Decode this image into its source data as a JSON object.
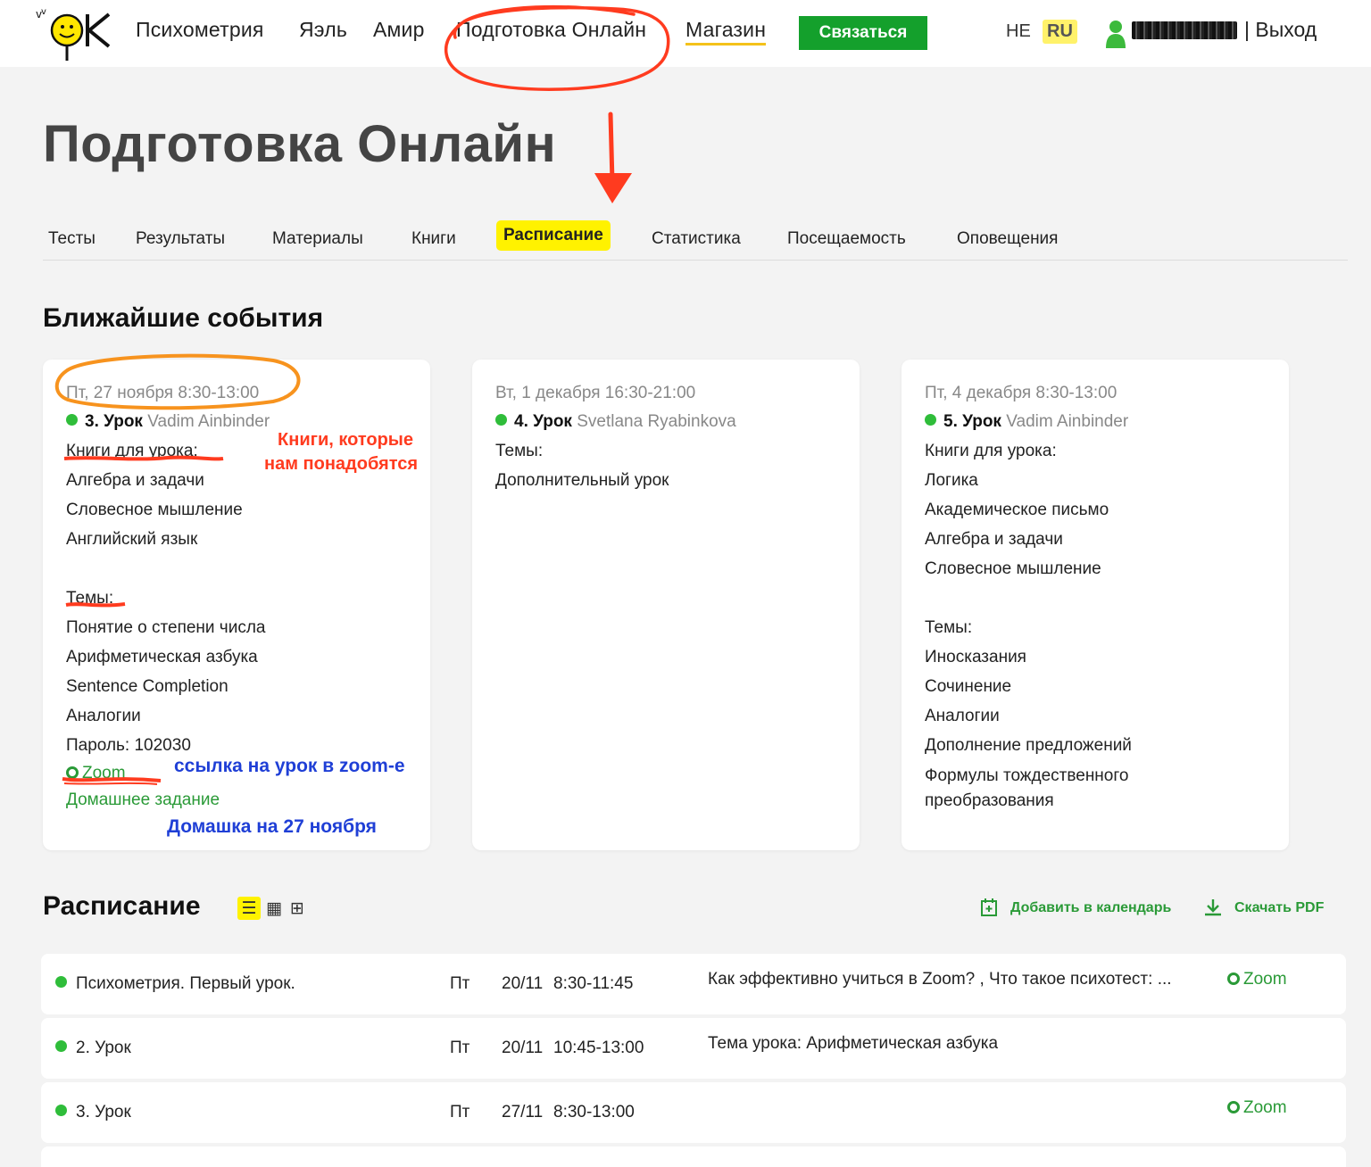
{
  "nav": {
    "links": [
      "Психометрия",
      "Яэль",
      "Амир",
      "Подготовка Онлайн",
      "Магазин"
    ],
    "contact_label": "Связаться",
    "lang_he": "HE",
    "lang_ru": "RU",
    "logout_label": "| Выход"
  },
  "page_title": "Подготовка Онлайн",
  "tabs": [
    "Тесты",
    "Результаты",
    "Материалы",
    "Книги",
    "Расписание",
    "Статистика",
    "Посещаемость",
    "Оповещения"
  ],
  "active_tab": "Расписание",
  "upcoming": {
    "heading": "Ближайшие события",
    "cards": [
      {
        "date": "Пт, 27 ноября 8:30-13:00",
        "lesson": "3. Урок",
        "teacher": "Vadim Ainbinder",
        "books_label": "Книги для урока:",
        "books": [
          "Алгебра и задачи",
          "Словесное мышление",
          "Английский язык"
        ],
        "topics_label": "Темы:",
        "topics": [
          "Понятие о степени числа",
          "Арифметическая азбука",
          "Sentence Completion",
          "Аналогии"
        ],
        "password": "Пароль: 102030",
        "zoom_label": "Zoom",
        "homework_label": "Домашнее задание"
      },
      {
        "date": "Вт, 1 декабря 16:30-21:00",
        "lesson": "4. Урок",
        "teacher": "Svetlana Ryabinkova",
        "topics_label": "Темы:",
        "topics": [
          "Дополнительный урок"
        ]
      },
      {
        "date": "Пт, 4 декабря 8:30-13:00",
        "lesson": "5. Урок",
        "teacher": "Vadim Ainbinder",
        "books_label": "Книги для урока:",
        "books": [
          "Логика",
          "Академическое письмо",
          "Алгебра и задачи",
          "Словесное мышление"
        ],
        "topics_label": "Темы:",
        "topics": [
          "Иносказания",
          "Сочинение",
          "Аналогии",
          "Дополнение предложений",
          "Формулы тождественного",
          "преобразования"
        ]
      }
    ]
  },
  "annotations": {
    "books_note_1": "Книги, которые",
    "books_note_2": "нам понадобятся",
    "zoom_note": "ссылка на урок в zoom-е",
    "homework_note": "Домашка на 27 ноября"
  },
  "schedule": {
    "heading": "Расписание",
    "view_icons": [
      "list-view-icon",
      "table-view-icon",
      "grid-view-icon"
    ],
    "add_calendar_label": "Добавить в календарь",
    "download_pdf_label": "Скачать PDF",
    "rows": [
      {
        "title": "Психометрия. Первый урок.",
        "day": "Пт",
        "date": "20/11",
        "time": "8:30-11:45",
        "desc": "Как эффективно учиться в Zoom? ,   Что такое психотест: ...",
        "zoom": "Zoom"
      },
      {
        "title": "2. Урок",
        "day": "Пт",
        "date": "20/11",
        "time": "10:45-13:00",
        "desc": "Тема урока: Арифметическая азбука",
        "zoom": ""
      },
      {
        "title": "3. Урок",
        "day": "Пт",
        "date": "27/11",
        "time": "8:30-13:00",
        "desc": "",
        "zoom": "Zoom"
      }
    ]
  },
  "colors": {
    "accent_green": "#14a02c",
    "highlight_yellow": "#fff200",
    "annotation_red": "#ff3b1f",
    "annotation_orange": "#f7931e",
    "annotation_blue": "#1f3fd6"
  }
}
